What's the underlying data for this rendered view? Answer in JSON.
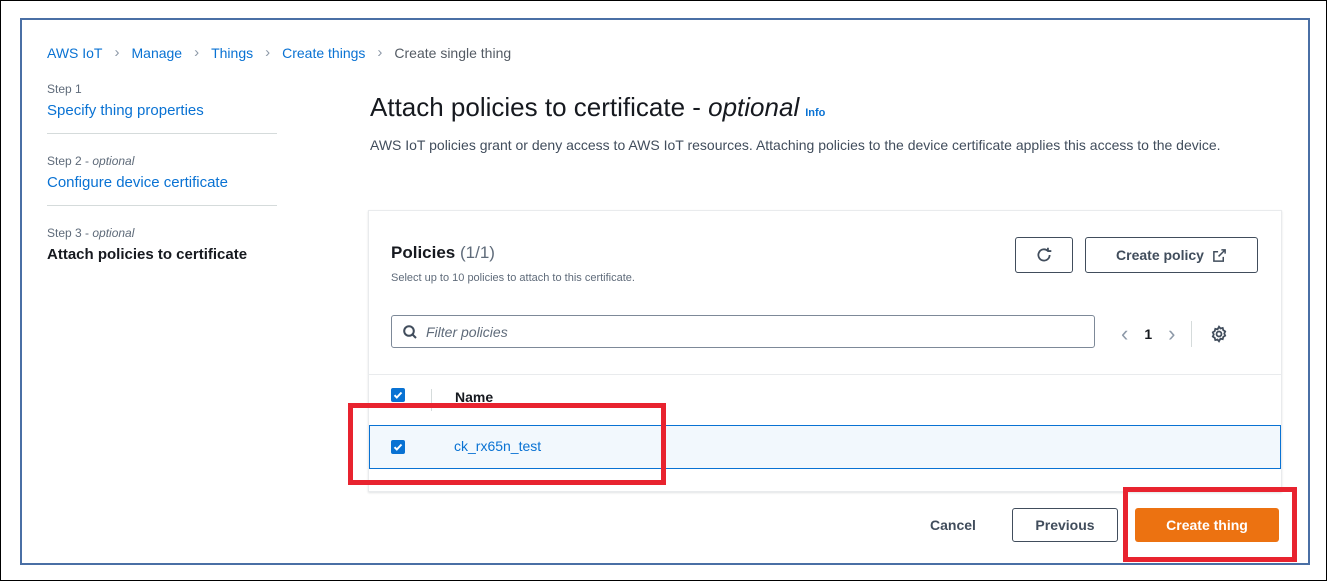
{
  "breadcrumb": {
    "items": [
      "AWS IoT",
      "Manage",
      "Things",
      "Create things"
    ],
    "current": "Create single thing"
  },
  "steps": [
    {
      "label": "Step 1",
      "title": "Specify thing properties"
    },
    {
      "label": "Step 2 - ",
      "label_optional": "optional",
      "title": "Configure device certificate"
    },
    {
      "label": "Step 3 - ",
      "label_optional": "optional",
      "title": "Attach policies to certificate"
    }
  ],
  "page": {
    "title": "Attach policies to certificate - ",
    "title_optional": "optional",
    "info_link": "Info",
    "description": "AWS IoT policies grant or deny access to AWS IoT resources. Attaching policies to the device certificate applies this access to the device."
  },
  "policies": {
    "title": "Policies",
    "count": "(1/1)",
    "subtitle": "Select up to 10 policies to attach to this certificate.",
    "create_policy_label": "Create policy",
    "filter_placeholder": "Filter policies",
    "current_page": "1",
    "column_name": "Name",
    "rows": [
      {
        "name": "ck_rx65n_test",
        "selected": true
      }
    ]
  },
  "actions": {
    "cancel": "Cancel",
    "previous": "Previous",
    "create_thing": "Create thing"
  },
  "colors": {
    "link": "#0972d3",
    "primary_button": "#ec7211",
    "highlight": "#e8232f"
  }
}
